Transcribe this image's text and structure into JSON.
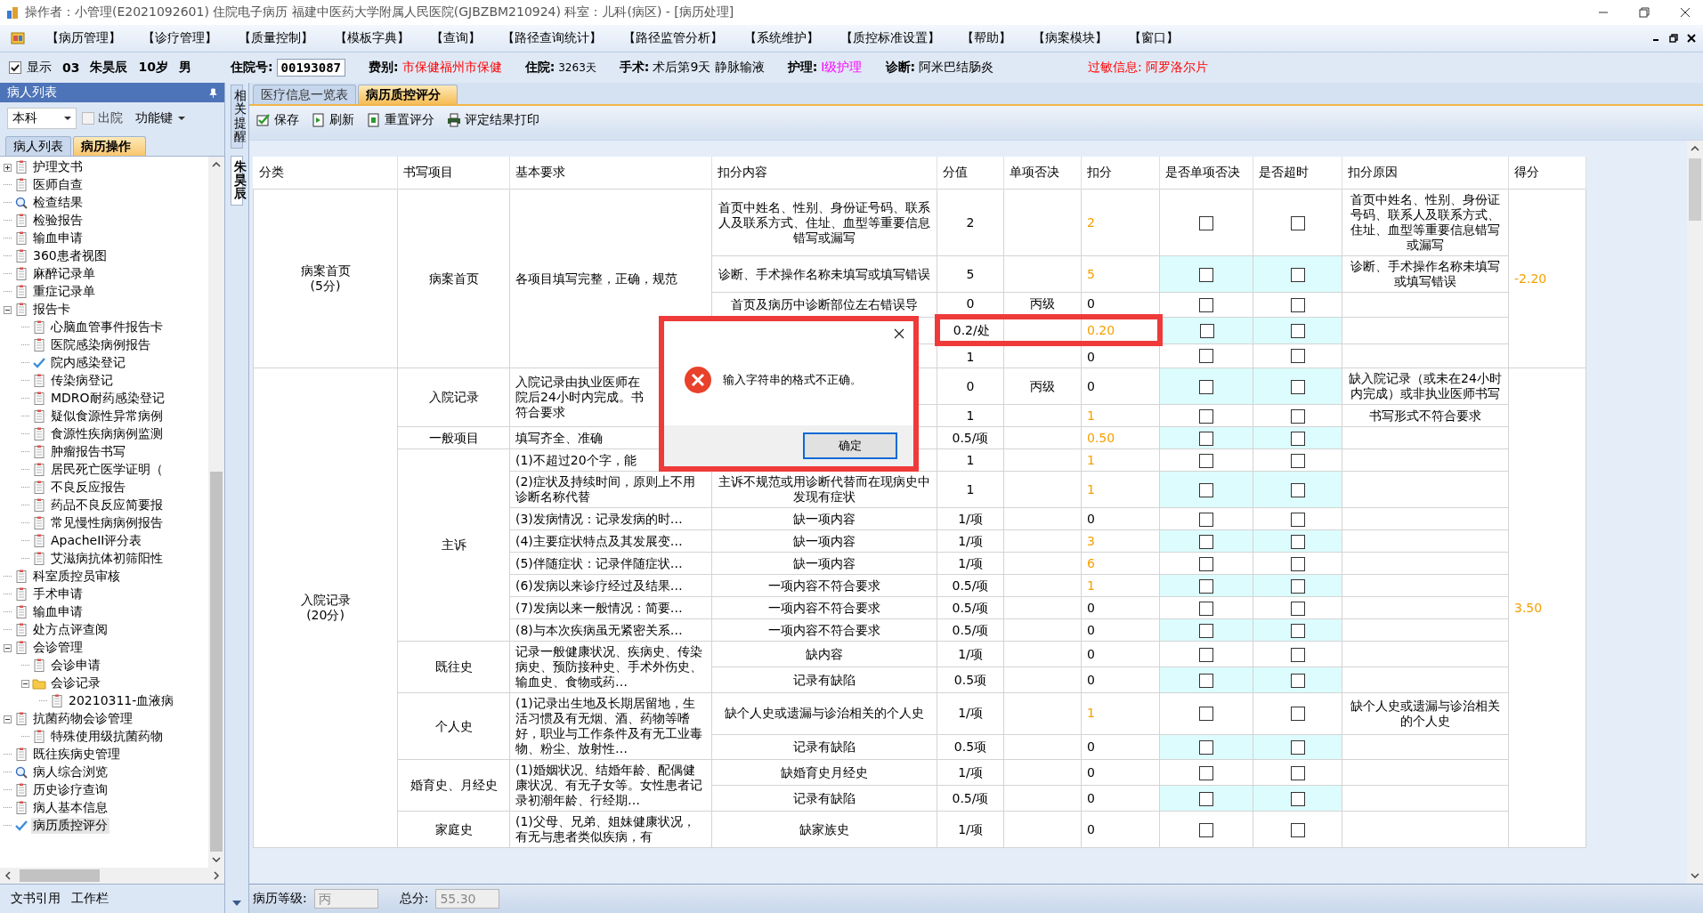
{
  "window": {
    "title": "操作者：小管理(E2021092601) 住院电子病历  福建中医药大学附属人民医院(GJBZBM210924)  科室：儿科(病区) - [病历处理]"
  },
  "menu": [
    "【病历管理】",
    "【诊疗管理】",
    "【质量控制】",
    "【模板字典】",
    "【查询】",
    "【路径查询统计】",
    "【路径监管分析】",
    "【系统维护】",
    "【质控标准设置】",
    "【帮助】",
    "【病案模块】",
    "【窗口】"
  ],
  "patient": {
    "show": {
      "label": "显示",
      "checked": true
    },
    "bed": "03",
    "name": "朱昊辰",
    "age": "10岁",
    "sex": "男",
    "fields": [
      {
        "label": "住院号:",
        "value": "00193087",
        "kind": "boxed",
        "color": "#000000"
      },
      {
        "label": "费别:",
        "value": "市保健福州市保健",
        "kind": "plain",
        "color": "#ff0000"
      },
      {
        "label": "住院:",
        "value": "3263天",
        "kind": "small",
        "color": "#000000"
      },
      {
        "label": "手术:",
        "value": "术后第9天  静脉输液",
        "kind": "plain",
        "color": "#000000"
      },
      {
        "label": "护理:",
        "value": "Ⅰ级护理",
        "kind": "plain",
        "color": "#ff00ff"
      },
      {
        "label": "诊断:",
        "value": "阿米巴结肠炎",
        "kind": "plain",
        "color": "#000000"
      },
      {
        "label": "过敏信息:",
        "value": "阿罗洛尔片",
        "kind": "alert",
        "color": "#ff0000"
      }
    ]
  },
  "left_panel": {
    "title": "病人列表",
    "dept": "本科",
    "discharged": {
      "label": "出院",
      "checked": false
    },
    "function_key": "功能键",
    "tabs": [
      {
        "label": "病人列表",
        "selected": false
      },
      {
        "label": "病历操作",
        "selected": true
      }
    ],
    "tree": [
      {
        "label": "护理文书",
        "kind": "doc",
        "expanded": false,
        "selected": false
      },
      {
        "label": "医师自查",
        "kind": "doc",
        "selected": false
      },
      {
        "label": "检查结果",
        "kind": "search",
        "selected": false
      },
      {
        "label": "检验报告",
        "kind": "doc",
        "selected": false
      },
      {
        "label": "输血申请",
        "kind": "doc",
        "selected": false
      },
      {
        "label": "360患者视图",
        "kind": "doc",
        "selected": false
      },
      {
        "label": "麻醉记录单",
        "kind": "doc",
        "selected": false
      },
      {
        "label": "重症记录单",
        "kind": "doc",
        "selected": false
      },
      {
        "label": "报告卡",
        "kind": "doc",
        "expanded": true,
        "selected": false,
        "children": [
          {
            "label": "心脑血管事件报告卡",
            "kind": "doc",
            "selected": false
          },
          {
            "label": "医院感染病例报告",
            "kind": "doc",
            "selected": false
          },
          {
            "label": "院内感染登记",
            "kind": "check",
            "selected": false
          },
          {
            "label": "传染病登记",
            "kind": "doc",
            "selected": false
          },
          {
            "label": "MDRO耐药感染登记",
            "kind": "doc",
            "selected": false
          },
          {
            "label": "疑似食源性异常病例",
            "kind": "doc",
            "selected": false
          },
          {
            "label": "食源性疾病病例监测",
            "kind": "doc",
            "selected": false
          },
          {
            "label": "肿瘤报告书写",
            "kind": "doc",
            "selected": false
          },
          {
            "label": "居民死亡医学证明（",
            "kind": "doc",
            "selected": false
          },
          {
            "label": "不良反应报告",
            "kind": "doc",
            "selected": false
          },
          {
            "label": "药品不良反应简要报",
            "kind": "doc",
            "selected": false
          },
          {
            "label": "常见慢性病病例报告",
            "kind": "doc",
            "selected": false
          },
          {
            "label": "ApacheII评分表",
            "kind": "doc",
            "selected": false
          },
          {
            "label": "艾滋病抗体初筛阳性",
            "kind": "doc",
            "selected": false
          }
        ]
      },
      {
        "label": "科室质控员审核",
        "kind": "doc",
        "selected": false
      },
      {
        "label": "手术申请",
        "kind": "doc",
        "selected": false
      },
      {
        "label": "输血申请",
        "kind": "doc",
        "selected": false
      },
      {
        "label": "处方点评查阅",
        "kind": "doc",
        "selected": false
      },
      {
        "label": "会诊管理",
        "kind": "doc",
        "expanded": true,
        "selected": false,
        "children": [
          {
            "label": "会诊申请",
            "kind": "doc",
            "selected": false
          },
          {
            "label": "会诊记录",
            "kind": "folder",
            "expanded": true,
            "selected": false,
            "children": [
              {
                "label": "20210311-血液病",
                "kind": "doc",
                "selected": false
              }
            ]
          }
        ]
      },
      {
        "label": "抗菌药物会诊管理",
        "kind": "doc",
        "expanded": true,
        "selected": false,
        "children": [
          {
            "label": "特殊使用级抗菌药物",
            "kind": "doc",
            "selected": false
          }
        ]
      },
      {
        "label": "既往疾病史管理",
        "kind": "doc",
        "selected": false
      },
      {
        "label": "病人综合浏览",
        "kind": "search",
        "selected": false
      },
      {
        "label": "历史诊疗查询",
        "kind": "doc",
        "selected": false
      },
      {
        "label": "病人基本信息",
        "kind": "doc",
        "selected": false
      },
      {
        "label": "病历质控评分",
        "kind": "check",
        "selected": true
      }
    ],
    "bottom_tabs": [
      "文书引用",
      "工作栏"
    ]
  },
  "side_tabs": [
    {
      "label": "相关提醒",
      "selected": false
    },
    {
      "label": "朱昊辰",
      "selected": true
    }
  ],
  "tabs": [
    {
      "label": "医疗信息一览表",
      "selected": false
    },
    {
      "label": "病历质控评分",
      "selected": true
    }
  ],
  "toolbar": [
    {
      "label": "保存",
      "kind": "save"
    },
    {
      "label": "刷新",
      "kind": "refresh"
    },
    {
      "label": "重置评分",
      "kind": "reset"
    },
    {
      "label": "评定结果打印",
      "kind": "print"
    }
  ],
  "table": {
    "columns": [
      "分类",
      "书写项目",
      "基本要求",
      "扣分内容",
      "分值",
      "单项否决",
      "扣分",
      "是否单项否决",
      "是否超时",
      "扣分原因",
      "得分"
    ],
    "categories": [
      {
        "label": "病案首页\n(5分)",
        "score": "-2.20",
        "items": [
          {
            "label": "病案首页",
            "requirements": [
              {
                "text": "各项目填写完整，正确，规范",
                "rows": [
                  {
                    "content": "首页中姓名、性别、身份证号码、联系人及联系方式、住址、血型等重要信息错写或漏写",
                    "value": "2",
                    "deduct": "2",
                    "flagged": true,
                    "veto_checked": false,
                    "overtime_checked": false,
                    "reason": "首页中姓名、性别、身份证号码、联系人及联系方式、住址、血型等重要信息错写或漏写"
                  },
                  {
                    "content": "诊断、手术操作名称未填写或填写错误",
                    "value": "5",
                    "deduct": "5",
                    "flagged": true,
                    "veto_checked": false,
                    "overtime_checked": false,
                    "reason": "诊断、手术操作名称未填写或填写错误"
                  },
                  {
                    "content": "首页及病历中诊断部位左右错误导",
                    "value": "0",
                    "veto": "丙级",
                    "deduct": "0",
                    "flagged": false,
                    "veto_checked": false,
                    "overtime_checked": false
                  },
                  {
                    "value": "0.2/处",
                    "deduct": "0.20",
                    "flagged": true,
                    "annotated": true,
                    "veto_checked": false,
                    "overtime_checked": false
                  },
                  {
                    "value": "1",
                    "deduct": "0",
                    "flagged": false,
                    "veto_checked": false,
                    "overtime_checked": false
                  }
                ]
              }
            ]
          }
        ]
      },
      {
        "label": "入院记录\n(20分)",
        "score": "3.50",
        "items": [
          {
            "label": "入院记录",
            "requirements": [
              {
                "lines": [
                  "入院记录由执业医师在",
                  "院后24小时内完成。书",
                  "符合要求"
                ],
                "rows": [
                  {
                    "value": "0",
                    "veto": "丙级",
                    "deduct": "0",
                    "flagged": false,
                    "veto_checked": false,
                    "overtime_checked": false,
                    "reason": "缺入院记录（或未在24小时内完成）或非执业医师书写"
                  },
                  {
                    "value": "1",
                    "deduct": "1",
                    "flagged": true,
                    "veto_checked": false,
                    "overtime_checked": false,
                    "reason": "书写形式不符合要求"
                  }
                ]
              }
            ]
          },
          {
            "label": "一般项目",
            "requirements": [
              {
                "text": "填写齐全、准确",
                "rows": [
                  {
                    "value": "0.5/项",
                    "deduct": "0.50",
                    "flagged": true,
                    "veto_checked": false,
                    "overtime_checked": false
                  }
                ]
              }
            ]
          },
          {
            "label": "主诉",
            "requirements": [
              {
                "text": "(1)不超过20个字，能",
                "rows": [
                  {
                    "value": "1",
                    "deduct": "1",
                    "flagged": true,
                    "veto_checked": false,
                    "overtime_checked": false
                  }
                ]
              },
              {
                "text": "(2)症状及持续时间，原则上不用诊断名称代替",
                "rows": [
                  {
                    "content": "主诉不规范或用诊断代替而在现病史中发现有症状",
                    "value": "1",
                    "deduct": "1",
                    "flagged": true,
                    "veto_checked": false,
                    "overtime_checked": false
                  }
                ]
              },
              {
                "text": "(3)发病情况：记录发病的时…",
                "rows": [
                  {
                    "content": "缺一项内容",
                    "value": "1/项",
                    "deduct": "0",
                    "flagged": false,
                    "veto_checked": false,
                    "overtime_checked": false
                  }
                ]
              },
              {
                "text": "(4)主要症状特点及其发展变…",
                "rows": [
                  {
                    "content": "缺一项内容",
                    "value": "1/项",
                    "deduct": "3",
                    "flagged": true,
                    "veto_checked": false,
                    "overtime_checked": false
                  }
                ]
              },
              {
                "text": "(5)伴随症状：记录伴随症状…",
                "rows": [
                  {
                    "content": "缺一项内容",
                    "value": "1/项",
                    "deduct": "6",
                    "flagged": true,
                    "veto_checked": false,
                    "overtime_checked": false
                  }
                ]
              },
              {
                "text": "(6)发病以来诊疗经过及结果…",
                "rows": [
                  {
                    "content": "一项内容不符合要求",
                    "value": "0.5/项",
                    "deduct": "1",
                    "flagged": true,
                    "veto_checked": false,
                    "overtime_checked": false
                  }
                ]
              },
              {
                "text": "(7)发病以来一般情况：简要…",
                "rows": [
                  {
                    "content": "一项内容不符合要求",
                    "value": "0.5/项",
                    "deduct": "0",
                    "flagged": false,
                    "veto_checked": false,
                    "overtime_checked": false
                  }
                ]
              },
              {
                "text": "(8)与本次疾病虽无紧密关系…",
                "rows": [
                  {
                    "content": "一项内容不符合要求",
                    "value": "0.5/项",
                    "deduct": "0",
                    "flagged": false,
                    "veto_checked": false,
                    "overtime_checked": false
                  }
                ]
              }
            ]
          },
          {
            "label": "既往史",
            "requirements": [
              {
                "text": "记录一般健康状况、疾病史、传染病史、预防接种史、手术外伤史、输血史、食物或药…",
                "rows": [
                  {
                    "content": "缺内容",
                    "value": "1/项",
                    "deduct": "0",
                    "flagged": false,
                    "veto_checked": false,
                    "overtime_checked": false
                  },
                  {
                    "content": "记录有缺陷",
                    "value": "0.5项",
                    "deduct": "0",
                    "flagged": false,
                    "veto_checked": false,
                    "overtime_checked": false
                  }
                ]
              }
            ]
          },
          {
            "label": "个人史",
            "requirements": [
              {
                "text": "(1)记录出生地及长期居留地，生活习惯及有无烟、酒、药物等嗜好，职业与工作条件及有无工业毒物、粉尘、放射性…",
                "rows": [
                  {
                    "content": "缺个人史或遗漏与诊治相关的个人史",
                    "value": "1/项",
                    "deduct": "1",
                    "flagged": true,
                    "veto_checked": false,
                    "overtime_checked": false,
                    "reason": "缺个人史或遗漏与诊治相关的个人史"
                  },
                  {
                    "content": "记录有缺陷",
                    "value": "0.5项",
                    "deduct": "0",
                    "flagged": false,
                    "veto_checked": false,
                    "overtime_checked": false
                  }
                ]
              }
            ]
          },
          {
            "label": "婚育史、月经史",
            "requirements": [
              {
                "text": "(1)婚姻状况、结婚年龄、配偶健康状况、有无子女等。女性患者记录初潮年龄、行经期…",
                "rows": [
                  {
                    "content": "缺婚育史月经史",
                    "value": "1/项",
                    "deduct": "0",
                    "flagged": false,
                    "veto_checked": false,
                    "overtime_checked": false
                  },
                  {
                    "content": "记录有缺陷",
                    "value": "0.5/项",
                    "deduct": "0",
                    "flagged": false,
                    "veto_checked": false,
                    "overtime_checked": false
                  }
                ]
              }
            ]
          },
          {
            "label": "家庭史",
            "requirements": [
              {
                "text": "(1)父母、兄弟、姐妹健康状况，有无与患者类似疾病，有",
                "rows": [
                  {
                    "content": "缺家族史",
                    "value": "1/项",
                    "deduct": "0",
                    "flagged": false,
                    "veto_checked": false,
                    "overtime_checked": false
                  }
                ]
              }
            ]
          }
        ]
      }
    ]
  },
  "footer": {
    "grade_label": "病历等级:",
    "grade": "丙",
    "total_label": "总分:",
    "total": "55.30"
  },
  "dialog": {
    "message": "输入字符串的格式不正确。",
    "button": "确定"
  }
}
